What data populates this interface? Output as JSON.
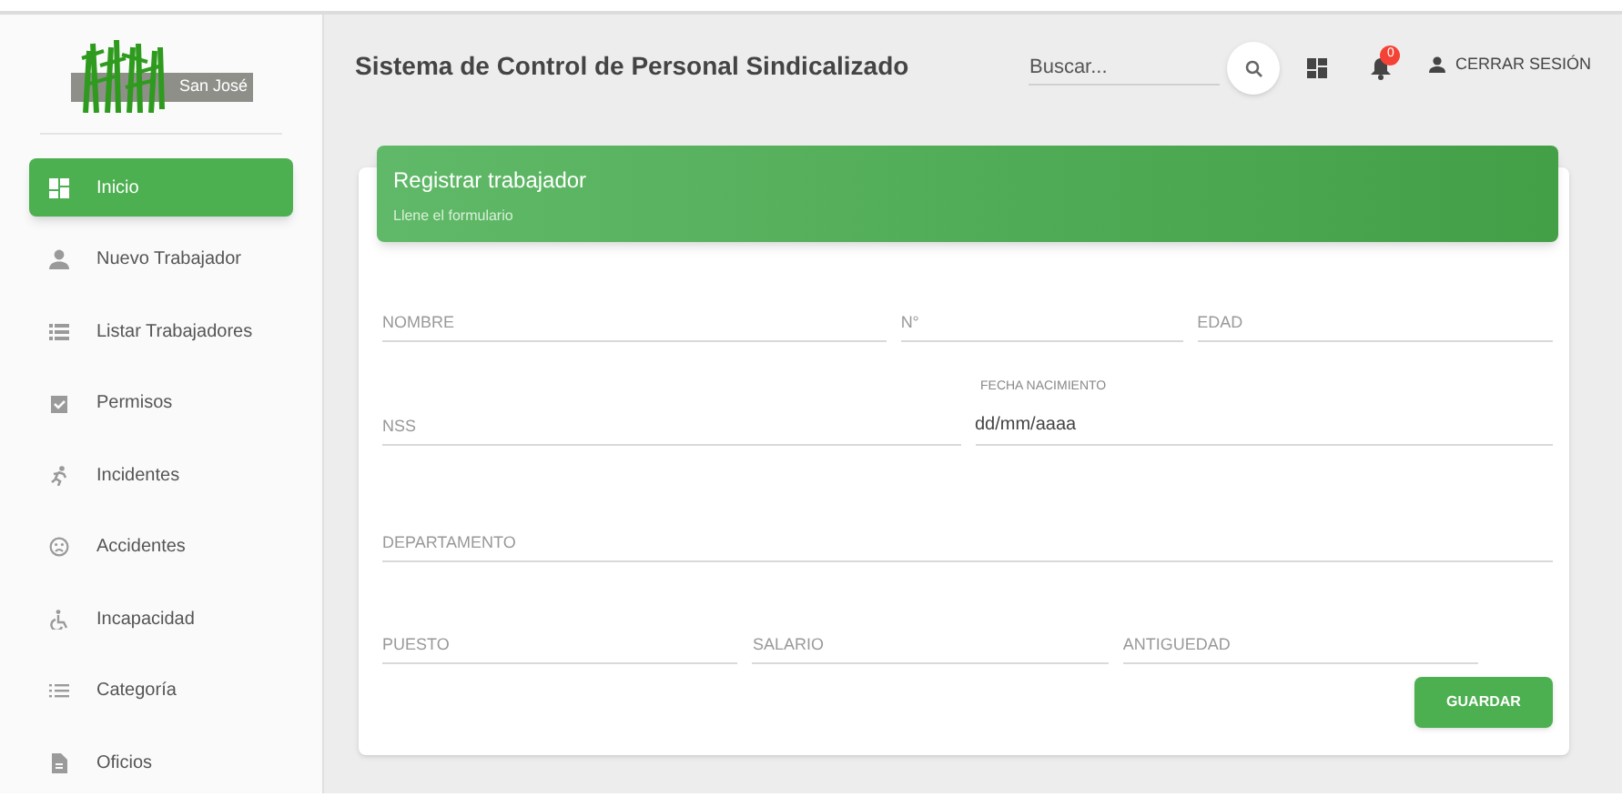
{
  "logo": {
    "text": "San José"
  },
  "sidebar": {
    "items": [
      {
        "label": "Inicio",
        "selected": true
      },
      {
        "label": "Nuevo Trabajador",
        "selected": false
      },
      {
        "label": "Listar Trabajadores",
        "selected": false
      },
      {
        "label": "Permisos",
        "selected": false
      },
      {
        "label": "Incidentes",
        "selected": false
      },
      {
        "label": "Accidentes",
        "selected": false
      },
      {
        "label": "Incapacidad",
        "selected": false
      },
      {
        "label": "Categoría",
        "selected": false
      },
      {
        "label": "Oficios",
        "selected": false
      }
    ]
  },
  "header": {
    "title": "Sistema de Control de Personal Sindicalizado",
    "search": {
      "placeholder": "Buscar..."
    },
    "notifications": "0",
    "logout": "CERRAR SESIÓN"
  },
  "card": {
    "title": "Registrar trabajador",
    "subtitle": "Llene el formulario",
    "rows": [
      [
        {
          "placeholder": "NOMBRE"
        },
        {
          "placeholder": "N°"
        },
        {
          "placeholder": "EDAD"
        }
      ],
      [
        {
          "placeholder": "NSS"
        },
        {
          "label": "FECHA NACIMIENTO",
          "value": "dd/mm/aaaa"
        }
      ],
      [
        {
          "placeholder": "DEPARTAMENTO"
        }
      ],
      [
        {
          "placeholder": "PUESTO"
        },
        {
          "placeholder": "SALARIO"
        },
        {
          "placeholder": "ANTIGUEDAD"
        }
      ]
    ],
    "button": "GUARDAR"
  }
}
